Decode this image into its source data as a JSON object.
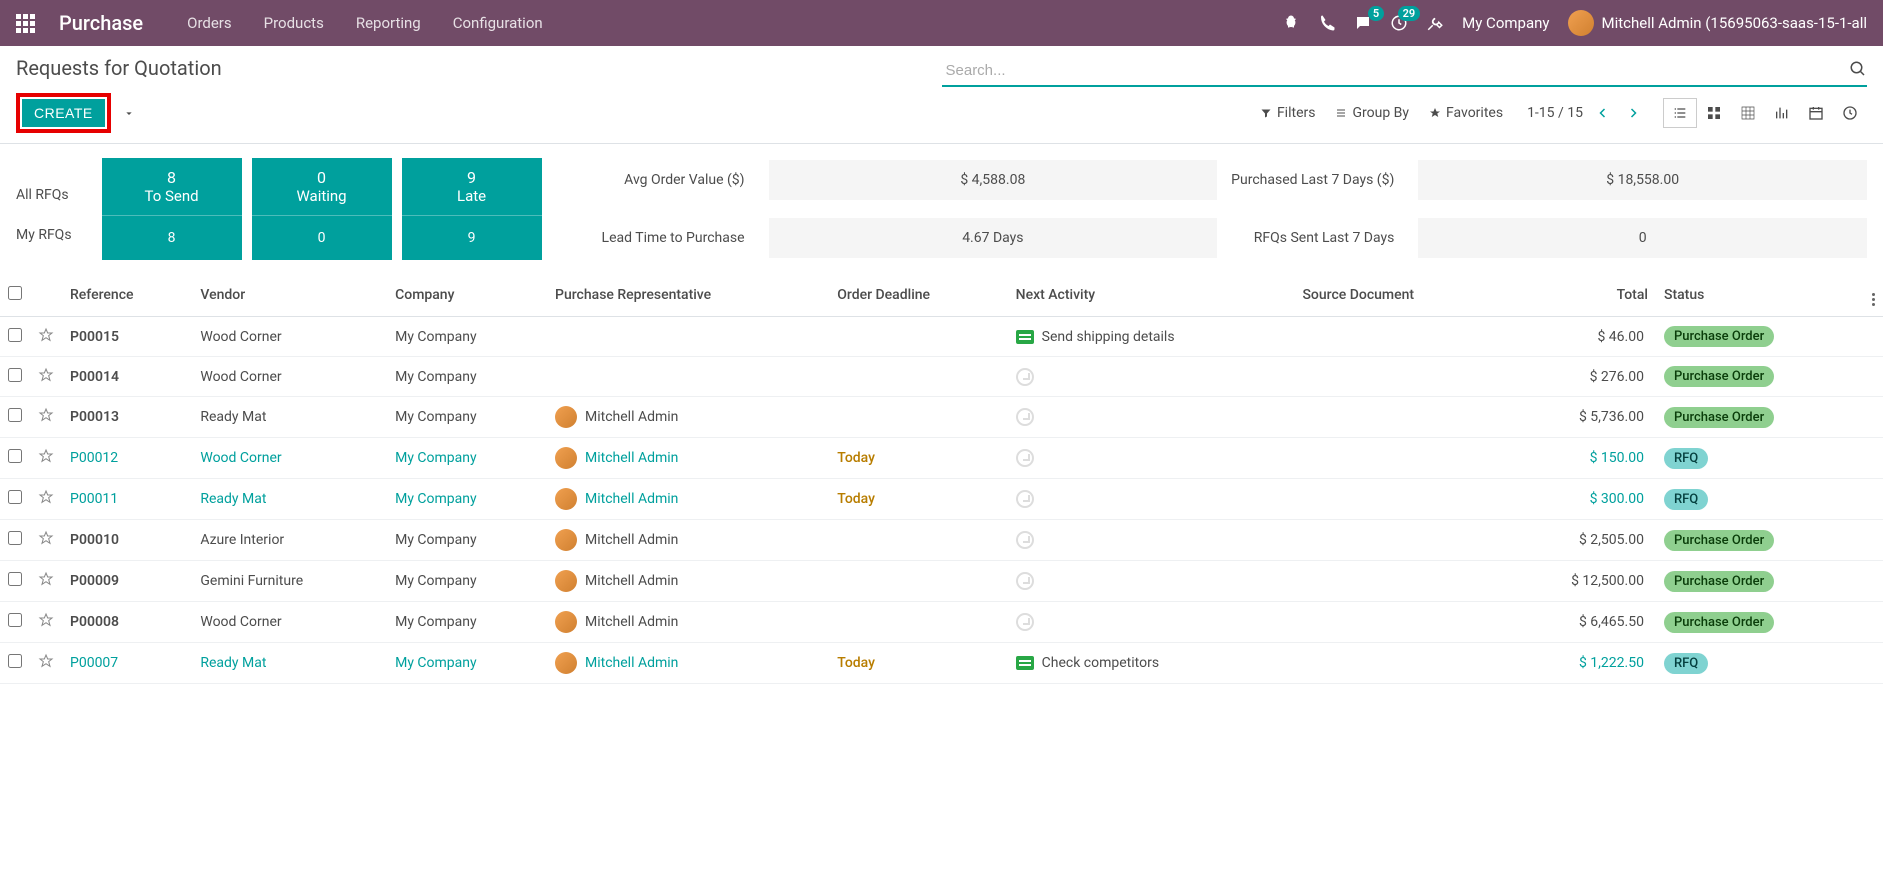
{
  "navbar": {
    "app_title": "Purchase",
    "menu": [
      "Orders",
      "Products",
      "Reporting",
      "Configuration"
    ],
    "messages_badge": "5",
    "activities_badge": "29",
    "company": "My Company",
    "user": "Mitchell Admin (15695063-saas-15-1-all"
  },
  "breadcrumb": "Requests for Quotation",
  "buttons": {
    "create": "CREATE"
  },
  "search": {
    "placeholder": "Search...",
    "filters": "Filters",
    "group_by": "Group By",
    "favorites": "Favorites"
  },
  "pager": {
    "text": "1-15 / 15"
  },
  "dashboard": {
    "all_label": "All RFQs",
    "my_label": "My RFQs",
    "to_send": {
      "label": "To Send",
      "all": "8",
      "my": "8"
    },
    "waiting": {
      "label": "Waiting",
      "all": "0",
      "my": "0"
    },
    "late": {
      "label": "Late",
      "all": "9",
      "my": "9"
    },
    "avg_order_label": "Avg Order Value ($)",
    "avg_order_val": "$ 4,588.08",
    "lead_time_label": "Lead Time to Purchase",
    "lead_time_val": "4.67  Days",
    "purchased_label": "Purchased Last 7 Days ($)",
    "purchased_val": "$ 18,558.00",
    "rfqs_sent_label": "RFQs Sent Last 7 Days",
    "rfqs_sent_val": "0"
  },
  "columns": {
    "reference": "Reference",
    "vendor": "Vendor",
    "company": "Company",
    "rep": "Purchase Representative",
    "deadline": "Order Deadline",
    "activity": "Next Activity",
    "source": "Source Document",
    "total": "Total",
    "status": "Status"
  },
  "rows": [
    {
      "ref": "P00015",
      "vendor": "Wood Corner",
      "company": "My Company",
      "rep": "",
      "deadline": "",
      "activity": "Send shipping details",
      "activity_type": "green",
      "total": "$ 46.00",
      "status": "Purchase Order",
      "status_class": "po",
      "link": false
    },
    {
      "ref": "P00014",
      "vendor": "Wood Corner",
      "company": "My Company",
      "rep": "",
      "deadline": "",
      "activity": "",
      "activity_type": "empty",
      "total": "$ 276.00",
      "status": "Purchase Order",
      "status_class": "po",
      "link": false
    },
    {
      "ref": "P00013",
      "vendor": "Ready Mat",
      "company": "My Company",
      "rep": "Mitchell Admin",
      "deadline": "",
      "activity": "",
      "activity_type": "empty",
      "total": "$ 5,736.00",
      "status": "Purchase Order",
      "status_class": "po",
      "link": false
    },
    {
      "ref": "P00012",
      "vendor": "Wood Corner",
      "company": "My Company",
      "rep": "Mitchell Admin",
      "deadline": "Today",
      "activity": "",
      "activity_type": "empty",
      "total": "$ 150.00",
      "status": "RFQ",
      "status_class": "rfq",
      "link": true
    },
    {
      "ref": "P00011",
      "vendor": "Ready Mat",
      "company": "My Company",
      "rep": "Mitchell Admin",
      "deadline": "Today",
      "activity": "",
      "activity_type": "empty",
      "total": "$ 300.00",
      "status": "RFQ",
      "status_class": "rfq",
      "link": true
    },
    {
      "ref": "P00010",
      "vendor": "Azure Interior",
      "company": "My Company",
      "rep": "Mitchell Admin",
      "deadline": "",
      "activity": "",
      "activity_type": "empty",
      "total": "$ 2,505.00",
      "status": "Purchase Order",
      "status_class": "po",
      "link": false
    },
    {
      "ref": "P00009",
      "vendor": "Gemini Furniture",
      "company": "My Company",
      "rep": "Mitchell Admin",
      "deadline": "",
      "activity": "",
      "activity_type": "empty",
      "total": "$ 12,500.00",
      "status": "Purchase Order",
      "status_class": "po",
      "link": false
    },
    {
      "ref": "P00008",
      "vendor": "Wood Corner",
      "company": "My Company",
      "rep": "Mitchell Admin",
      "deadline": "",
      "activity": "",
      "activity_type": "empty",
      "total": "$ 6,465.50",
      "status": "Purchase Order",
      "status_class": "po",
      "link": false
    },
    {
      "ref": "P00007",
      "vendor": "Ready Mat",
      "company": "My Company",
      "rep": "Mitchell Admin",
      "deadline": "Today",
      "activity": "Check competitors",
      "activity_type": "green",
      "total": "$ 1,222.50",
      "status": "RFQ",
      "status_class": "rfq",
      "link": true
    }
  ]
}
